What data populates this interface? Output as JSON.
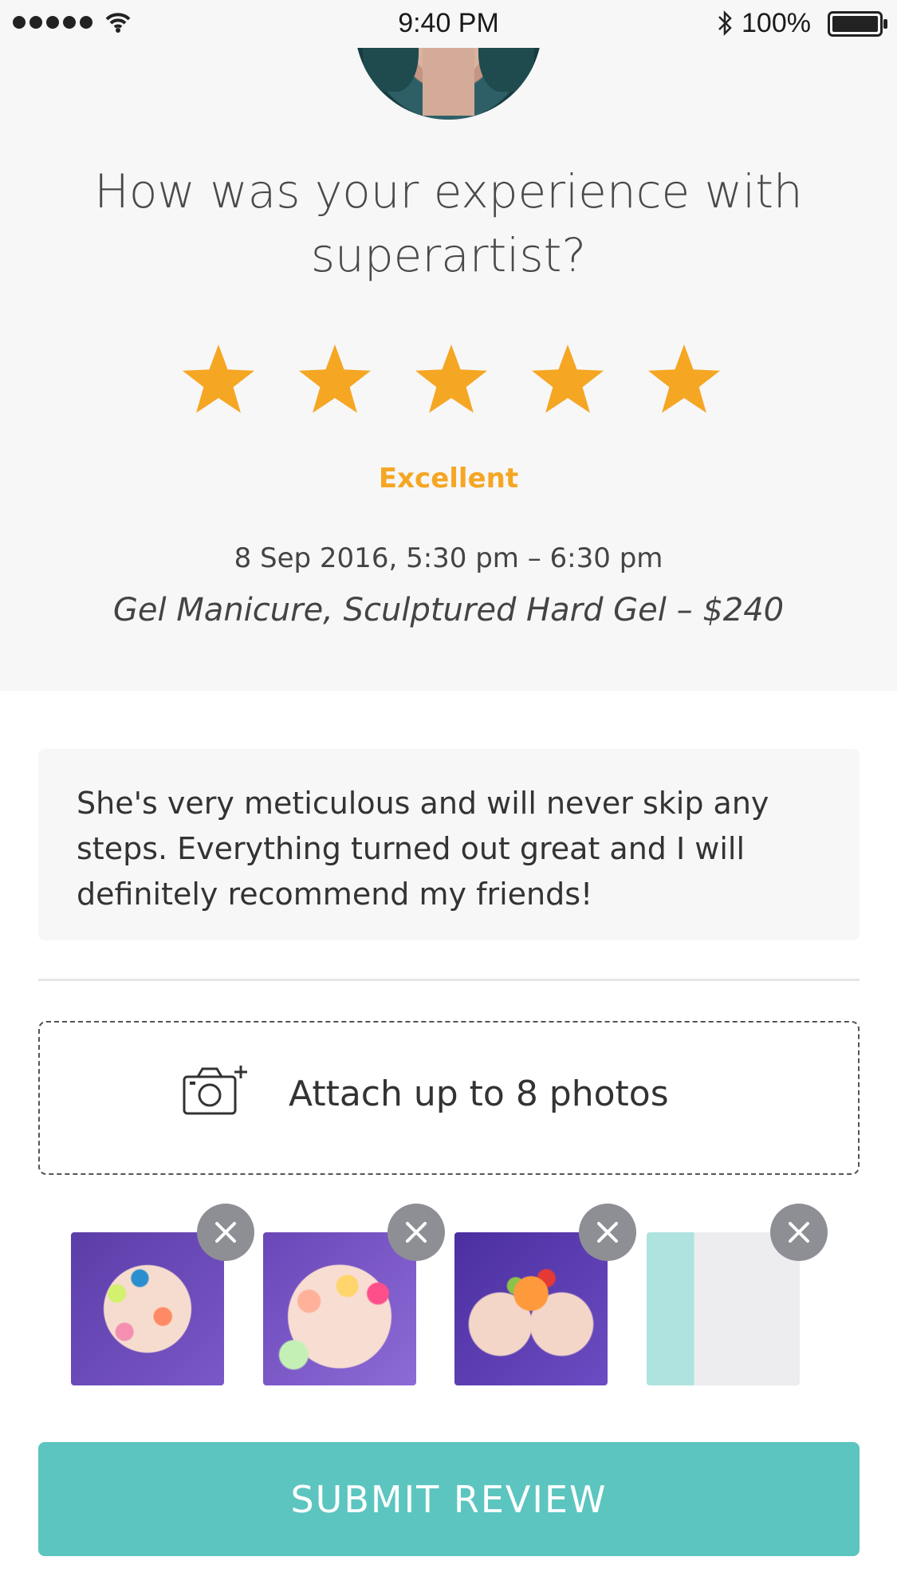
{
  "status_bar": {
    "time": "9:40 PM",
    "battery": "100%",
    "icons": [
      "signal-dots-icon",
      "wifi-icon",
      "bluetooth-icon",
      "battery-icon"
    ]
  },
  "review": {
    "question": "How was your experience with superartist?",
    "rating_stars": 5,
    "rating_max": 5,
    "rating_label": "Excellent",
    "appointment_time": "8 Sep 2016, 5:30 pm – 6:30 pm",
    "service": "Gel Manicure, Sculptured Hard Gel – $240",
    "text": "She's very meticulous and will never skip any steps. Everything turned out great and I will definitely recommend my friends!"
  },
  "attach": {
    "label": "Attach up to 8 photos",
    "icon": "camera-add-icon"
  },
  "photos": {
    "count": 4,
    "remove_icon": "close-icon"
  },
  "submit_label": "SUBMIT REVIEW",
  "colors": {
    "star": "#F5A623",
    "rating_label": "#F5A623",
    "submit_bg": "#5CC5BF",
    "remove_bg": "#8E8F94",
    "top_bg": "#F7F7F7"
  }
}
